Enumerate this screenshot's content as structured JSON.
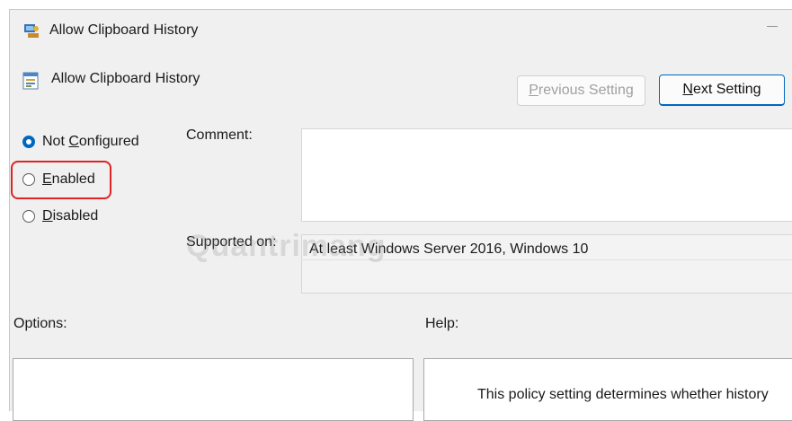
{
  "window": {
    "title": "Allow Clipboard History",
    "title_icon": "group-policy-icon"
  },
  "header": {
    "policy_name": "Allow Clipboard History",
    "policy_icon": "policy-setting-icon",
    "previous_button": {
      "pre": "",
      "mnemonic": "P",
      "post": "revious Setting"
    },
    "next_button": {
      "pre": "",
      "mnemonic": "N",
      "post": "ext Setting"
    }
  },
  "state": {
    "options": [
      {
        "pre": "Not ",
        "mnemonic": "C",
        "post": "onfigured",
        "selected": true
      },
      {
        "pre": "",
        "mnemonic": "E",
        "post": "nabled",
        "selected": false
      },
      {
        "pre": "",
        "mnemonic": "D",
        "post": "isabled",
        "selected": false
      }
    ],
    "highlight_color": "#e02424"
  },
  "comment": {
    "label": "Comment:",
    "value": ""
  },
  "supported": {
    "label": "Supported on:",
    "value": "At least Windows Server 2016, Windows 10"
  },
  "options_section": {
    "label": "Options:"
  },
  "help_section": {
    "label": "Help:",
    "text": "This policy setting determines whether history"
  },
  "watermark": "Quantrimang",
  "colors": {
    "accent": "#0067c0",
    "disabled_text": "#a0a0a0"
  }
}
